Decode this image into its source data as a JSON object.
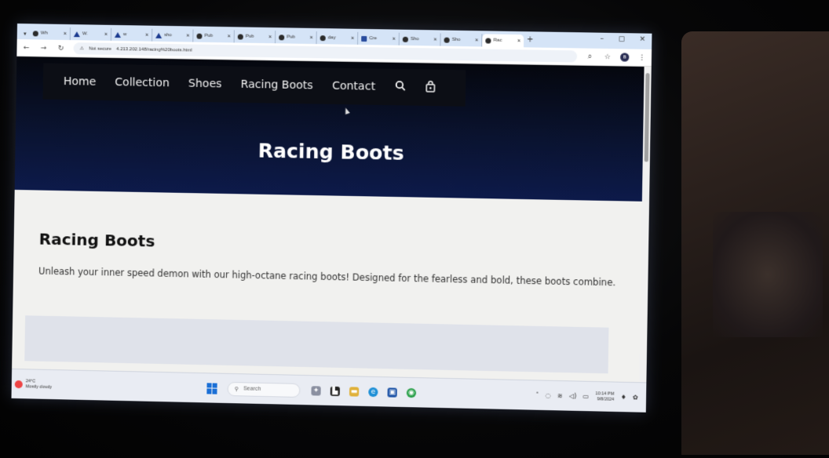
{
  "browser": {
    "tabs": [
      {
        "label": "Wh",
        "icon": "globe-icon"
      },
      {
        "label": "W.",
        "icon": "a-logo-icon"
      },
      {
        "label": "w",
        "icon": "a-logo-icon"
      },
      {
        "label": "sho",
        "icon": "a-logo-icon"
      },
      {
        "label": "Pub",
        "icon": "globe-icon"
      },
      {
        "label": "Pub",
        "icon": "globe-icon"
      },
      {
        "label": "Pub",
        "icon": "globe-icon"
      },
      {
        "label": "day",
        "icon": "github-icon"
      },
      {
        "label": "Cre",
        "icon": "grid-icon"
      },
      {
        "label": "Sho",
        "icon": "globe-icon"
      },
      {
        "label": "Sho",
        "icon": "globe-icon"
      },
      {
        "label": "Rac",
        "icon": "globe-icon",
        "active": true
      }
    ],
    "security_label": "Not secure",
    "url": "4.213.202.148/racing%20boots.html",
    "profile_initial": "B"
  },
  "site": {
    "nav": {
      "links": [
        "Home",
        "Collection",
        "Shoes",
        "Racing Boots",
        "Contact"
      ],
      "search_icon": "search-icon",
      "cart_icon": "shopping-bag-icon"
    },
    "hero_title": "Racing Boots",
    "section_title": "Racing Boots",
    "section_text": "Unleash your inner speed demon with our high-octane racing boots! Designed for the fearless and bold, these boots combine."
  },
  "taskbar": {
    "weather_temp": "24°C",
    "weather_desc": "Mostly cloudy",
    "search_placeholder": "Search",
    "time": "10:14 PM",
    "date": "9/8/2024"
  },
  "colors": {
    "hero_top": "#05070e",
    "hero_bottom": "#0d1a4a",
    "navbar_bg": "#0c0e15",
    "page_bg": "#f1f1ef",
    "tabstrip_bg": "#d5e4f7"
  }
}
